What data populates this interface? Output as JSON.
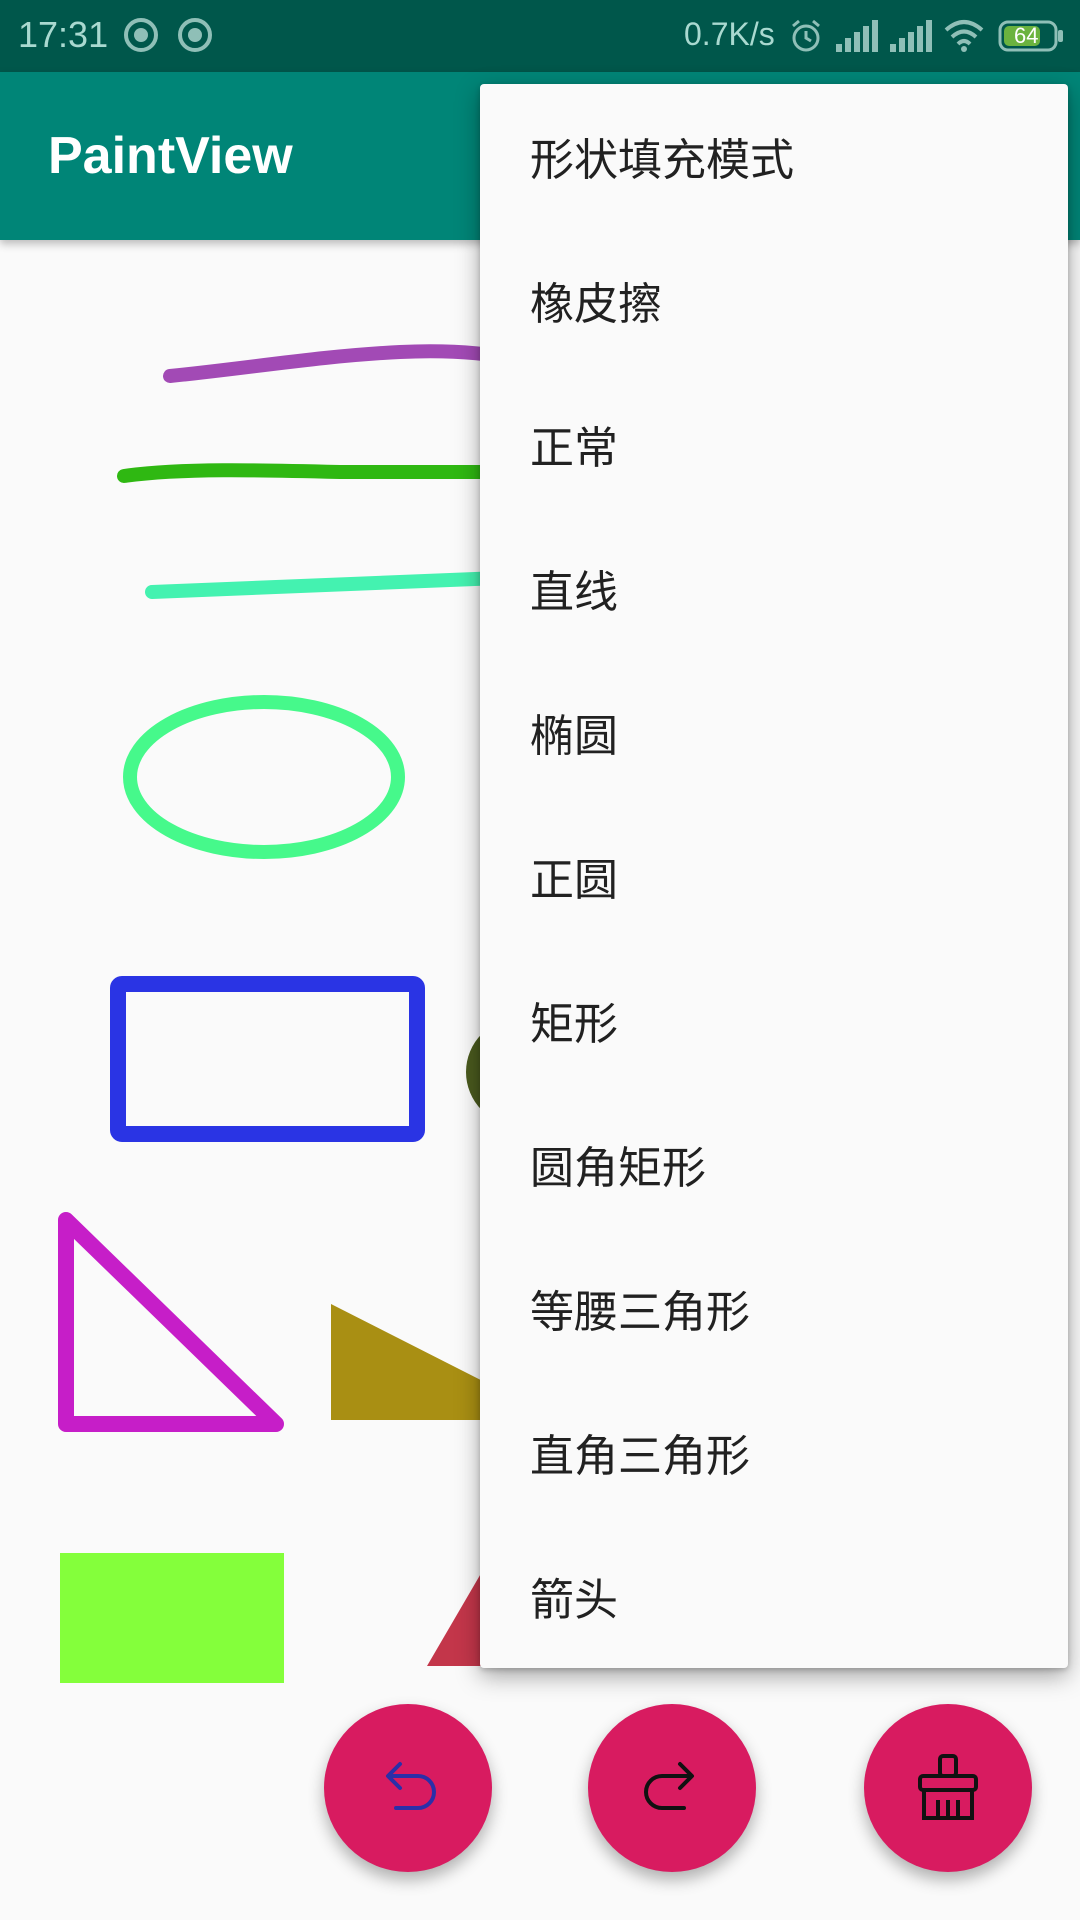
{
  "status_bar": {
    "time": "17:31",
    "network_speed": "0.7K/s",
    "battery_level": "64",
    "icons": [
      "notification-icon",
      "notification-icon",
      "alarm-icon",
      "signal-icon",
      "signal-icon",
      "wifi-icon",
      "battery-icon"
    ]
  },
  "app_bar": {
    "title": "PaintView"
  },
  "menu": {
    "items": [
      {
        "label": "形状填充模式"
      },
      {
        "label": "橡皮擦"
      },
      {
        "label": "正常"
      },
      {
        "label": "直线"
      },
      {
        "label": "椭圆"
      },
      {
        "label": "正圆"
      },
      {
        "label": "矩形"
      },
      {
        "label": "圆角矩形"
      },
      {
        "label": "等腰三角形"
      },
      {
        "label": "直角三角形"
      },
      {
        "label": "箭头"
      }
    ]
  },
  "canvas": {
    "drawings": [
      {
        "shape": "freehand-line",
        "color": "#a24ab5"
      },
      {
        "shape": "freehand-line",
        "color": "#2fb812"
      },
      {
        "shape": "straight-line",
        "color": "#44f2b0"
      },
      {
        "shape": "ellipse-outline",
        "color": "#46f98b"
      },
      {
        "shape": "rectangle-outline",
        "color": "#2a34e4"
      },
      {
        "shape": "circle-filled",
        "color": "#4a5a1e"
      },
      {
        "shape": "right-triangle-outline",
        "color": "#c61ec8"
      },
      {
        "shape": "triangle-filled",
        "color": "#a98f13"
      },
      {
        "shape": "rectangle-filled",
        "color": "#84ff3b"
      },
      {
        "shape": "triangle-filled",
        "color": "#c3364a"
      }
    ]
  },
  "fab_buttons": [
    {
      "name": "undo-button",
      "icon": "undo-icon"
    },
    {
      "name": "redo-button",
      "icon": "redo-icon"
    },
    {
      "name": "clear-button",
      "icon": "broom-icon"
    }
  ],
  "colors": {
    "status_bar": "#00574b",
    "app_bar": "#008577",
    "fab": "#d81b60",
    "menu_background": "#fafafa"
  }
}
